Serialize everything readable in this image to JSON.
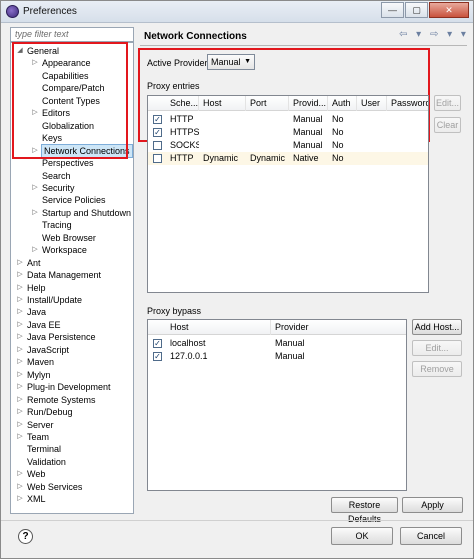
{
  "window": {
    "title": "Preferences",
    "close_symbol": "✕",
    "minimize_symbol": "—",
    "maximize_symbol": "▢"
  },
  "filter": {
    "placeholder": "type filter text"
  },
  "tree": {
    "items": [
      {
        "label": "General",
        "level": 0,
        "expanded": true
      },
      {
        "label": "Appearance",
        "level": 1,
        "arrow": true
      },
      {
        "label": "Capabilities",
        "level": 1
      },
      {
        "label": "Compare/Patch",
        "level": 1
      },
      {
        "label": "Content Types",
        "level": 1
      },
      {
        "label": "Editors",
        "level": 1,
        "arrow": true
      },
      {
        "label": "Globalization",
        "level": 1
      },
      {
        "label": "Keys",
        "level": 1
      },
      {
        "label": "Network Connections",
        "level": 1,
        "arrow": true,
        "selected": true
      },
      {
        "label": "Perspectives",
        "level": 1
      },
      {
        "label": "Search",
        "level": 1
      },
      {
        "label": "Security",
        "level": 1,
        "arrow": true
      },
      {
        "label": "Service Policies",
        "level": 1
      },
      {
        "label": "Startup and Shutdown",
        "level": 1,
        "arrow": true
      },
      {
        "label": "Tracing",
        "level": 1
      },
      {
        "label": "Web Browser",
        "level": 1
      },
      {
        "label": "Workspace",
        "level": 1,
        "arrow": true
      },
      {
        "label": "Ant",
        "level": 0,
        "arrow": true
      },
      {
        "label": "Data Management",
        "level": 0,
        "arrow": true
      },
      {
        "label": "Help",
        "level": 0,
        "arrow": true
      },
      {
        "label": "Install/Update",
        "level": 0,
        "arrow": true
      },
      {
        "label": "Java",
        "level": 0,
        "arrow": true
      },
      {
        "label": "Java EE",
        "level": 0,
        "arrow": true
      },
      {
        "label": "Java Persistence",
        "level": 0,
        "arrow": true
      },
      {
        "label": "JavaScript",
        "level": 0,
        "arrow": true
      },
      {
        "label": "Maven",
        "level": 0,
        "arrow": true
      },
      {
        "label": "Mylyn",
        "level": 0,
        "arrow": true
      },
      {
        "label": "Plug-in Development",
        "level": 0,
        "arrow": true
      },
      {
        "label": "Remote Systems",
        "level": 0,
        "arrow": true
      },
      {
        "label": "Run/Debug",
        "level": 0,
        "arrow": true
      },
      {
        "label": "Server",
        "level": 0,
        "arrow": true
      },
      {
        "label": "Team",
        "level": 0,
        "arrow": true
      },
      {
        "label": "Terminal",
        "level": 0
      },
      {
        "label": "Validation",
        "level": 0
      },
      {
        "label": "Web",
        "level": 0,
        "arrow": true
      },
      {
        "label": "Web Services",
        "level": 0,
        "arrow": true
      },
      {
        "label": "XML",
        "level": 0,
        "arrow": true
      }
    ]
  },
  "page": {
    "title": "Network Connections",
    "nav_arrows": "⇦ ▾ ⇨ ▾ ▾",
    "active_provider_label": "Active Provider:",
    "active_provider_value": "Manual",
    "proxy_entries_label": "Proxy entries",
    "proxy_bypass_label": "Proxy bypass"
  },
  "proxy_entries": {
    "columns": [
      "Sche...",
      "Host",
      "Port",
      "Provid...",
      "Auth",
      "User",
      "Password"
    ],
    "rows": [
      {
        "checked": true,
        "scheme": "HTTP",
        "host": "",
        "port": "",
        "provider": "Manual",
        "auth": "No",
        "user": "",
        "password": ""
      },
      {
        "checked": true,
        "scheme": "HTTPS",
        "host": "",
        "port": "",
        "provider": "Manual",
        "auth": "No",
        "user": "",
        "password": ""
      },
      {
        "checked": false,
        "scheme": "SOCKS",
        "host": "",
        "port": "",
        "provider": "Manual",
        "auth": "No",
        "user": "",
        "password": ""
      },
      {
        "checked": false,
        "scheme": "HTTP",
        "host": "Dynamic",
        "port": "Dynamic",
        "provider": "Native",
        "auth": "No",
        "user": "",
        "password": ""
      }
    ],
    "edit_button": "Edit...",
    "clear_button": "Clear"
  },
  "proxy_bypass": {
    "columns": [
      "Host",
      "Provider"
    ],
    "rows": [
      {
        "checked": true,
        "host": "localhost",
        "provider": "Manual"
      },
      {
        "checked": true,
        "host": "127.0.0.1",
        "provider": "Manual"
      }
    ],
    "add_button": "Add Host...",
    "edit_button": "Edit...",
    "remove_button": "Remove"
  },
  "buttons": {
    "restore_defaults": "Restore Defaults",
    "apply": "Apply",
    "ok": "OK",
    "cancel": "Cancel",
    "help": "?"
  }
}
